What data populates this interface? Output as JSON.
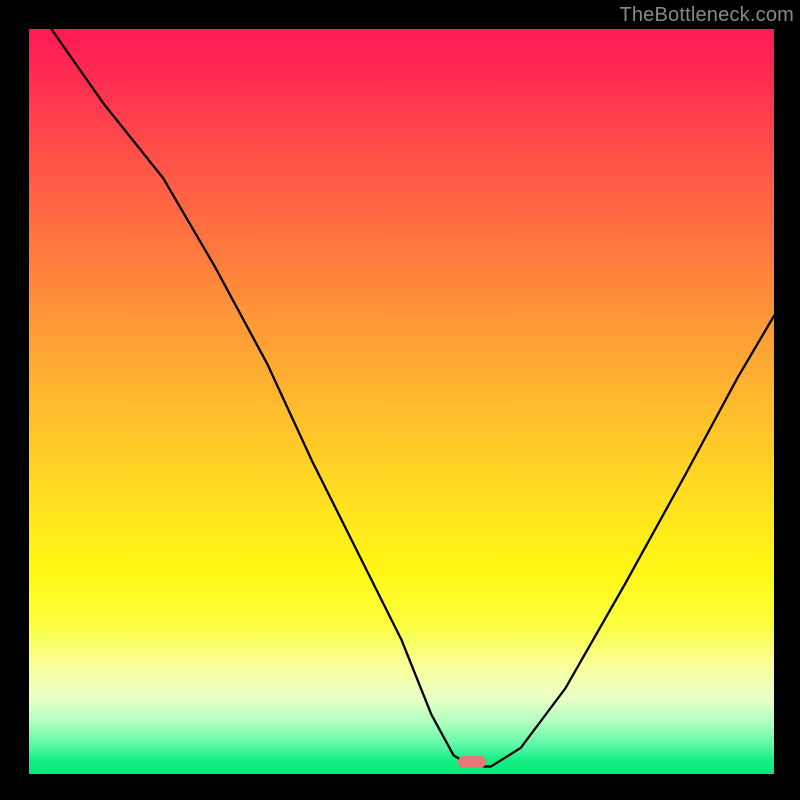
{
  "watermark": "TheBottleneck.com",
  "marker": {
    "cx_frac": 0.595,
    "cy_frac": 0.984
  },
  "chart_data": {
    "type": "line",
    "title": "",
    "xlabel": "",
    "ylabel": "",
    "xlim": [
      0,
      1
    ],
    "ylim": [
      0,
      1
    ],
    "series": [
      {
        "name": "curve",
        "x": [
          0.03,
          0.1,
          0.18,
          0.25,
          0.32,
          0.38,
          0.44,
          0.5,
          0.54,
          0.57,
          0.595,
          0.62,
          0.66,
          0.72,
          0.8,
          0.88,
          0.95,
          1.0
        ],
        "y": [
          1.0,
          0.9,
          0.8,
          0.68,
          0.55,
          0.42,
          0.3,
          0.18,
          0.08,
          0.025,
          0.01,
          0.01,
          0.035,
          0.115,
          0.255,
          0.4,
          0.53,
          0.615
        ]
      }
    ],
    "background_gradient": {
      "top": "#ff1a52",
      "mid": "#ffe41e",
      "bottom": "#00e878"
    }
  }
}
